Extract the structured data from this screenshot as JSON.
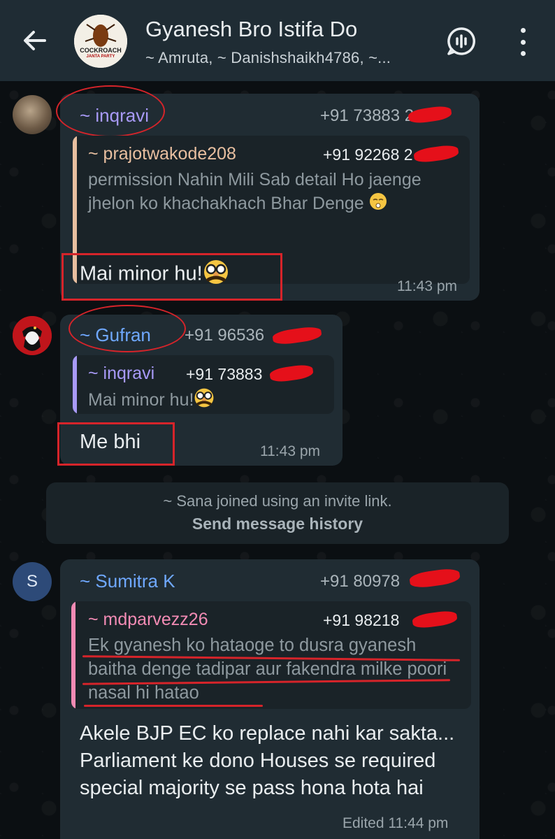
{
  "header": {
    "title": "Gyanesh Bro Istifa Do",
    "members": "~ Amruta, ~ Danishshaikh4786, ~...",
    "avatar_text": "COCKROACH",
    "avatar_subtext": "JANTA PARTY"
  },
  "messages": [
    {
      "sender": "~ inqravi",
      "phone": "+91 73883 2",
      "quote": {
        "sender": "~ prajotwakode208",
        "phone": "+91 92268 2",
        "text": "permission Nahin Mili  Sab detail Ho jaenge jhelon ko khachakhach Bhar Denge"
      },
      "text": "Mai minor hu!",
      "time": "11:43 pm"
    },
    {
      "sender": "~ Gufran",
      "phone": "+91 96536",
      "quote": {
        "sender": "~ inqravi",
        "phone": "+91 73883",
        "text": "Mai minor hu!"
      },
      "text": "Me bhi",
      "time": "11:43 pm"
    },
    {
      "sender": "~ Sumitra K",
      "avatar_letter": "S",
      "phone": "+91 80978",
      "quote": {
        "sender": "~ mdparvezz26",
        "phone": "+91 98218",
        "text": "Ek gyanesh ko hataoge to dusra gyanesh baitha denge tadipar aur fakendra milke poori nasal hi hatao"
      },
      "text": "Akele BJP EC ko replace nahi kar sakta... Parliament ke dono Houses se required special majority se pass hona hota hai",
      "time": "Edited 11:44 pm"
    }
  ],
  "system": {
    "line1": "~ Sana joined using an invite link.",
    "line2": "Send message history"
  },
  "colors": {
    "header_bg": "#1f2c34",
    "bubble_bg": "#202c33",
    "inqravi": "#a89af7",
    "prajot": "#e8bfa0",
    "gufran": "#6fa8ff",
    "sumitra": "#6fa8ff",
    "mdparvez": "#f28bb4",
    "annotation": "#d6242a"
  }
}
